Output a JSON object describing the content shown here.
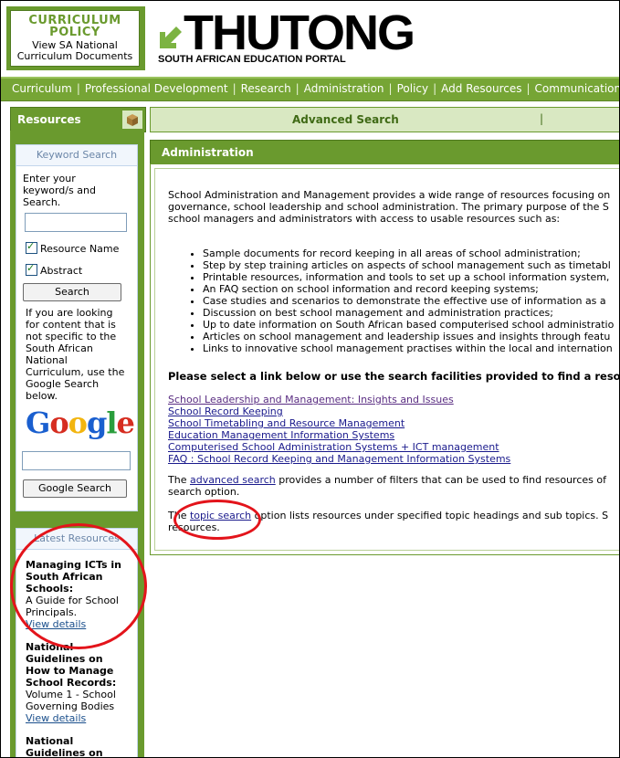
{
  "header": {
    "curriculum_policy_title": "CURRICULUM POLICY",
    "curriculum_policy_sub_1": "View SA National",
    "curriculum_policy_sub_2": "Curriculum Documents",
    "logo_text": "THUTONG",
    "logo_sub": "SOUTH AFRICAN EDUCATION PORTAL"
  },
  "nav": {
    "items": [
      "Curriculum",
      "Professional Development",
      "Research",
      "Administration",
      "Policy",
      "Add Resources",
      "Communications"
    ]
  },
  "sidebar": {
    "resources_label": "Resources",
    "keyword_search": {
      "title": "Keyword Search",
      "instructions_1": "Enter your",
      "instructions_2": "keyword/s and",
      "instructions_3": "Search.",
      "input_value": "",
      "resource_name_label": "Resource Name",
      "abstract_label": "Abstract",
      "search_button": "Search",
      "google_note": [
        "If you are looking",
        "for content that is",
        "not specific to the",
        "South African",
        "National",
        "Curriculum, use the",
        "Google Search",
        "below."
      ],
      "google_logo": "Google",
      "google_input_value": "",
      "google_button": "Google Search"
    },
    "latest_resources": {
      "title": "Latest Resources",
      "items": [
        {
          "title_lines": [
            "Managing ICTs in",
            "South African",
            "Schools:"
          ],
          "desc_lines": [
            "A Guide for School",
            "Principals."
          ],
          "link": "View details"
        },
        {
          "title_lines": [
            "National",
            "Guidelines on",
            "How to Manage",
            "School Records:"
          ],
          "desc_lines": [
            "Volume 1 - School",
            "Governing Bodies"
          ],
          "link": "View details"
        },
        {
          "title_lines": [
            "National",
            "Guidelines on"
          ],
          "desc_lines": [],
          "link": ""
        }
      ]
    }
  },
  "main": {
    "advanced_search_label": "Advanced Search",
    "advanced_search_sep": "|",
    "section_title": "Administration",
    "intro_lines": [
      "School Administration and Management provides a wide range of resources focusing on",
      "governance, school leadership and school administration. The primary purpose of the S",
      "school managers and administrators with access to usable resources such as:"
    ],
    "bullets": [
      "Sample documents for record keeping in all areas of school administration;",
      "Step by step training articles on aspects of school management such as timetabl",
      "Printable resources, information and tools to set up a school information system,",
      "An FAQ section on school information and record keeping systems;",
      "Case studies and scenarios to demonstrate the effective use of information as a",
      "Discussion on best school management and administration practices;",
      "Up to date information on South African based computerised school administratio",
      "Articles on school management and leadership issues and insights through featu",
      "Links to innovative school management practises within the local and internation"
    ],
    "select_line": "Please select a link below or use the search facilities provided to find a reso",
    "links": [
      "School Leadership and Management: Insights and Issues",
      "School Record Keeping",
      "School Timetabling and Resource Management",
      "Education Management Information Systems",
      "Computerised School Administration Systems + ICT management",
      "FAQ : School Record Keeping and Management Information Systems"
    ],
    "adv_para": {
      "before": "The ",
      "link": "advanced search",
      "after": " provides a number of filters that can be used to find resources of",
      "line2": "search option."
    },
    "topic_para": {
      "before": "The ",
      "link": "topic search",
      "after": " option lists resources under specified topic headings and sub topics. S",
      "line2": "resources."
    }
  },
  "colors": {
    "brand_green": "#6a9a2e",
    "nav_green": "#76a535",
    "annotation_red": "#e3141b"
  }
}
